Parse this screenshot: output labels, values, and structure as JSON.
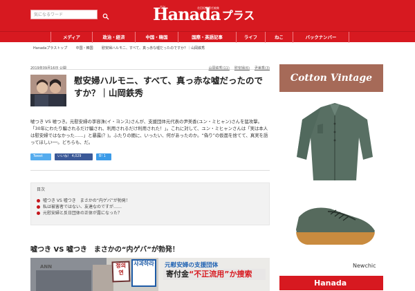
{
  "header": {
    "search_placeholder": "気になるワード",
    "logo": {
      "tagline": "月刊",
      "small_text": "花田紀凱責任編集",
      "main": "Hanada",
      "sub": "プラス"
    }
  },
  "nav": {
    "items": [
      "メディア",
      "政治・経済",
      "中国・韓国",
      "国際・英語記事",
      "ライフ",
      "ねこ",
      "バックナンバー"
    ]
  },
  "breadcrumb": {
    "items": [
      "Hanadaプラストップ",
      "中国・韓国",
      "慰安婦ハルモニ、すべて、真っ赤な嘘だったのですか？｜山岡鉄秀"
    ]
  },
  "article": {
    "date": "2019年09月16日 公開",
    "tags": [
      "山岡鉄秀(11)",
      "慰安婦(6)",
      "尹美香(3)"
    ],
    "title": "慰安婦ハルモニ、すべて、真っ赤な嘘だったのですか？｜山岡鉄秀",
    "lead": "嘘つき VS 嘘つき。元慰安婦の李容洙(イ・ヨンス)さんが、支援団体元代表の尹美香(ユン・ミヒャン)さんを猛攻撃。「30年にわたり騙されるだけ騙され、利用されるだけ利用された！」。これに対して、ユン・ミヒャンさんは「実は本人は慰安婦ではなかった……」と暴露(？)。ふたりの間に、いったい、何があったのか。“偽り”の仮面を捨てて、真実を語ってほしい──。どちらも、だ。",
    "share": {
      "tweet": "Tweet",
      "facebook": "いいね！ 4,029",
      "hatena": "B! 1"
    },
    "toc": {
      "title": "目次",
      "items": [
        "嘘つき VS 嘘つき　まさかの“内ゲバ”が勃発！",
        "私は被害者ではない、友達なのですが……",
        "元慰安婦と反日団体の正体が露になった？"
      ]
    },
    "section_heading": "嘘つき VS 嘘つき　まさかの“内ゲバ”が勃発！",
    "image": {
      "ann": "ANN",
      "sign1": "정의연",
      "sign2": "사과하라",
      "title_line1": "元慰安婦の支援団体",
      "title_line2_prefix": "寄付金",
      "title_line2_red": "“不正流用”か捜索"
    }
  },
  "ad": {
    "banner": "Cotton Vintage Looks",
    "brand": "Newchic",
    "bottom_banner": "Hanada"
  },
  "colors": {
    "brand_red": "#d71920",
    "link_gray": "#666666",
    "toc_bullet": "#c4161c"
  }
}
